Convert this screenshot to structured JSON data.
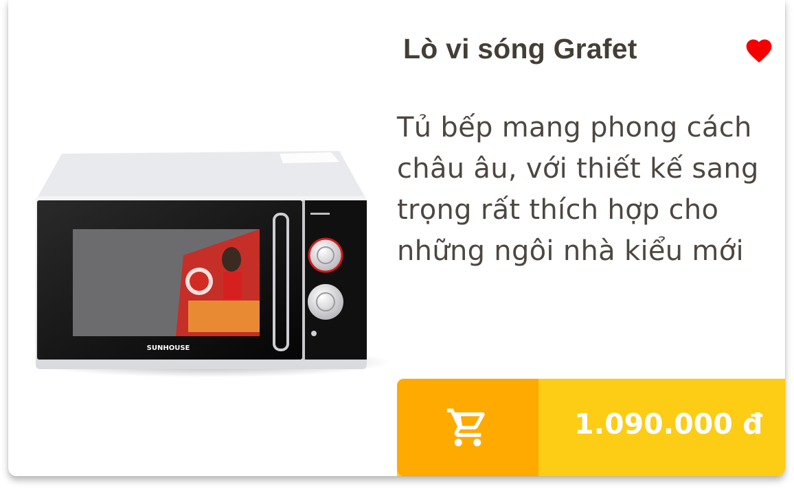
{
  "product": {
    "title": "Lò vi sóng Grafet",
    "description": "Tủ bếp mang phong cách châu âu, với thiết kế sang trọng rất thích hợp cho những ngôi nhà kiểu mới",
    "price": "1.090.000 đ",
    "image_brand_text": "SUNHOUSE",
    "image_alt": "microwave-oven-photo"
  },
  "icons": {
    "favorite": "heart-icon",
    "cart": "shopping-cart-icon"
  },
  "colors": {
    "title": "#433e36",
    "description": "#4d4741",
    "favorite": "#f50000",
    "cart_button": "#ffaa00",
    "price_bar": "#fdcc14",
    "price_text": "#ffffff"
  }
}
